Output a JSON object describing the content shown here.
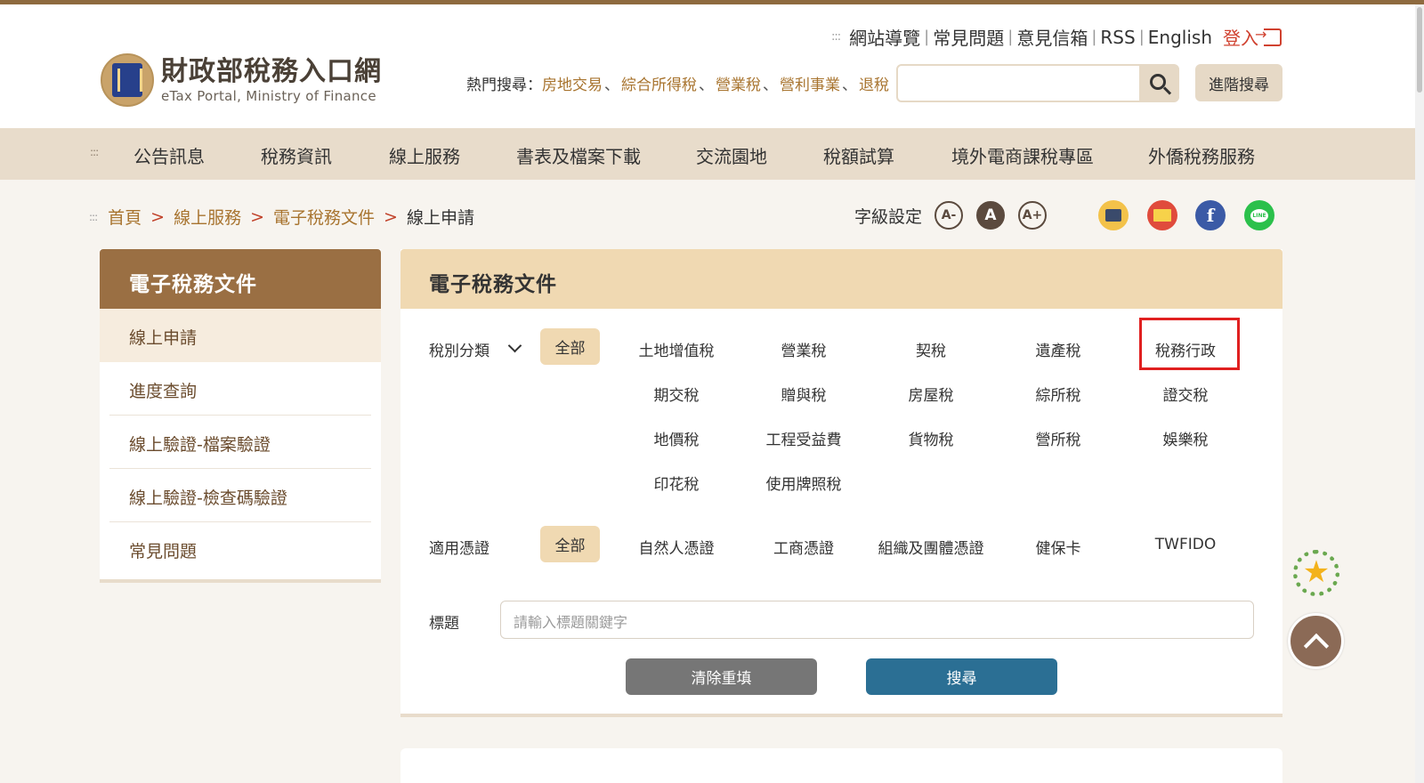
{
  "site": {
    "name_cn": "財政部稅務入口網",
    "name_en": "eTax Portal, Ministry of Finance"
  },
  "utility": {
    "links": [
      "網站導覽",
      "常見問題",
      "意見信箱",
      "RSS",
      "English"
    ],
    "login": "登入"
  },
  "hot_search": {
    "label": "熱門搜尋：",
    "keywords": [
      "房地交易",
      "綜合所得稅",
      "營業稅",
      "營利事業",
      "退稅"
    ],
    "input_value": "",
    "advanced": "進階搜尋"
  },
  "nav": {
    "items": [
      "公告訊息",
      "稅務資訊",
      "線上服務",
      "書表及檔案下載",
      "交流園地",
      "稅額試算",
      "境外電商課稅專區",
      "外僑稅務服務"
    ]
  },
  "breadcrumb": {
    "items": [
      "首頁",
      "線上服務",
      "電子稅務文件"
    ],
    "current": "線上申請"
  },
  "font_setting": {
    "label": "字級設定",
    "options": [
      "A-",
      "A",
      "A+"
    ]
  },
  "share": {
    "facebook": "f",
    "line": "LINE"
  },
  "sidebar": {
    "title": "電子稅務文件",
    "items": [
      "線上申請",
      "進度查詢",
      "線上驗證-檔案驗證",
      "線上驗證-檢查碼驗證",
      "常見問題"
    ]
  },
  "panel": {
    "title": "電子稅務文件",
    "tax_category": {
      "label": "稅別分類",
      "all": "全部",
      "options": [
        "土地增值稅",
        "營業稅",
        "契稅",
        "遺產稅",
        "稅務行政",
        "期交稅",
        "贈與稅",
        "房屋稅",
        "綜所稅",
        "證交稅",
        "地價稅",
        "工程受益費",
        "貨物稅",
        "營所稅",
        "娛樂稅",
        "印花稅",
        "使用牌照稅"
      ],
      "highlighted": "稅務行政"
    },
    "certificate": {
      "label": "適用憑證",
      "all": "全部",
      "options": [
        "自然人憑證",
        "工商憑證",
        "組織及團體憑證",
        "健保卡",
        "TWFIDO"
      ]
    },
    "title_field": {
      "label": "標題",
      "placeholder": "請輸入標題關鍵字",
      "value": ""
    },
    "clear_button": "清除重填",
    "search_button": "搜尋"
  },
  "colors": {
    "brand_brown": "#9a6f43",
    "nav_bg": "#e8dccb",
    "panel_head": "#f0d9b2",
    "link": "#a8742f",
    "login_red": "#d0412f",
    "search_blue": "#2b6f94",
    "highlight_red": "#e02020"
  }
}
